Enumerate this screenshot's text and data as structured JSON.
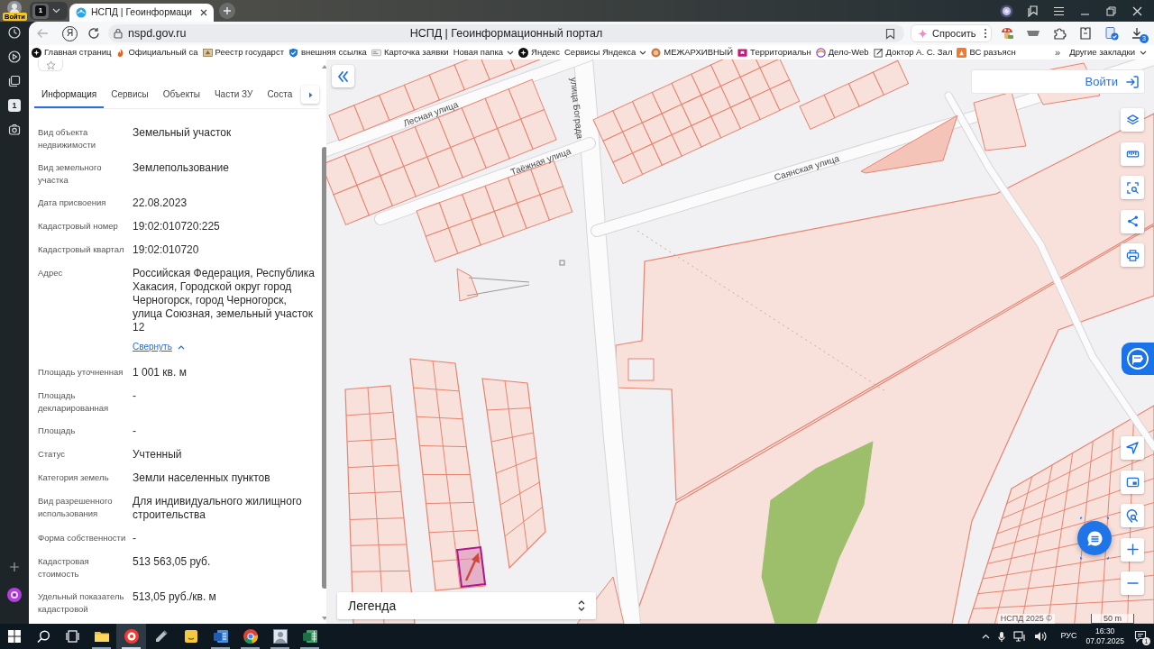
{
  "sidebar": {
    "login_badge": "Войти",
    "counter": "1"
  },
  "browser": {
    "tab_group": "1",
    "tabs": [
      {
        "title": "НСПД | Геоинформаци",
        "selected": true
      }
    ],
    "home_button": "Я",
    "address": "nspd.gov.ru",
    "page_title": "НСПД | Геоинформационный портал",
    "ask_button": "Спросить",
    "download_count": "3",
    "bookmarks": [
      {
        "label": "Главная страниц",
        "kind": "link"
      },
      {
        "label": "Официальный са",
        "kind": "link"
      },
      {
        "label": "Реестр государст",
        "kind": "link"
      },
      {
        "label": "внешняя ссылка",
        "kind": "link"
      },
      {
        "label": "Карточка заявки",
        "kind": "link"
      },
      {
        "label": "Новая папка",
        "kind": "folder"
      },
      {
        "label": "Яндекс",
        "kind": "link"
      },
      {
        "label": "Сервисы Яндекса",
        "kind": "folder"
      },
      {
        "label": "МЕЖАРХИВНЫЙ",
        "kind": "link"
      },
      {
        "label": "Территориальн",
        "kind": "link"
      },
      {
        "label": "Дело-Web",
        "kind": "link"
      },
      {
        "label": "Доктор А. С. Зал",
        "kind": "link"
      },
      {
        "label": "ВС разъясн",
        "kind": "link"
      }
    ],
    "more_bookmarks": "»",
    "other_bookmarks": "Другие закладки"
  },
  "info_panel": {
    "tabs": [
      {
        "label": "Информация",
        "selected": true
      },
      {
        "label": "Сервисы",
        "selected": false
      },
      {
        "label": "Объекты",
        "selected": false
      },
      {
        "label": "Части ЗУ",
        "selected": false
      },
      {
        "label": "Соста",
        "selected": false
      }
    ],
    "fields": [
      {
        "label": "Вид объекта недвижимости",
        "value": "Земельный участок"
      },
      {
        "label": "Вид земельного участка",
        "value": "Землепользование"
      },
      {
        "label": "Дата присвоения",
        "value": "22.08.2023"
      },
      {
        "label": "Кадастровый номер",
        "value": "19:02:010720:225"
      },
      {
        "label": "Кадастровый квартал",
        "value": "19:02:010720"
      },
      {
        "label": "Адрес",
        "value": "Российская Федерация, Республика Хакасия, Городской округ город Черногорск, город Черногорск, улица Союзная, земельный участок 12",
        "link": "Свернуть",
        "expanded": true
      },
      {
        "label": "Площадь уточненная",
        "value": "1 001 кв. м"
      },
      {
        "label": "Площадь декларированная",
        "value": "-"
      },
      {
        "label": "Площадь",
        "value": "-"
      },
      {
        "label": "Статус",
        "value": "Учтенный"
      },
      {
        "label": "Категория земель",
        "value": "Земли населенных пунктов"
      },
      {
        "label": "Вид разрешенного использования",
        "value": "Для индивидуального жилищного строительства"
      },
      {
        "label": "Форма собственности",
        "value": "-"
      },
      {
        "label": "Кадастровая стоимость",
        "value": "513 563,05 руб."
      },
      {
        "label": "Удельный показатель кадастровой",
        "value": "513,05 руб./кв. м"
      }
    ]
  },
  "map": {
    "streets": [
      "Лесная улица",
      "Таёжная улица",
      "улица Бограда",
      "Саянская улица"
    ],
    "login_button": "Войти",
    "legend": "Легенда",
    "attribution": "НСПД 2025 ©",
    "scale": "50 m"
  },
  "taskbar": {
    "apps": [
      {
        "kind": "explorer",
        "running": true,
        "selected": false
      },
      {
        "kind": "yandex-browser",
        "running": true,
        "selected": true
      },
      {
        "kind": "utility",
        "running": false,
        "selected": false
      },
      {
        "kind": "notes",
        "running": false,
        "selected": false
      },
      {
        "kind": "word",
        "running": true,
        "selected": false
      },
      {
        "kind": "chrome",
        "running": true,
        "selected": false
      },
      {
        "kind": "photo",
        "running": true,
        "selected": false
      },
      {
        "kind": "excel",
        "running": true,
        "selected": false
      }
    ],
    "language": "РУС",
    "time": "16:30",
    "date": "07.07.2025",
    "notification_count": "1"
  }
}
